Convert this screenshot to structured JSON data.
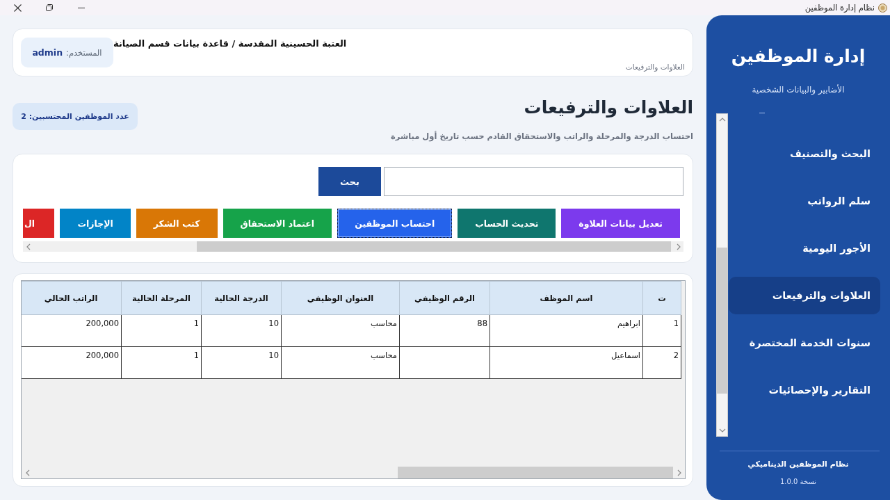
{
  "window": {
    "title": "نظام إدارة الموظفين"
  },
  "header": {
    "title": "العتبة الحسينية المقدسة / قاعدة بيانات قسم الصيانة",
    "user": "المستخدم: **admin**",
    "breadcrumb": "العلاوات والترفيعات"
  },
  "page": {
    "title": "العلاوات والترفيعات",
    "subtitle": "احتساب الدرجة والمرحلة والراتب والاستحقاق القادم حسب تاريخ أول مباشرة",
    "count": "عدد الموظفين المحتسبين: 2"
  },
  "search": {
    "button": "بحث"
  },
  "actions": [
    {
      "label": "تعديل بيانات العلاوة",
      "color": "#7c3aed",
      "focused": false
    },
    {
      "label": "تحديث الحساب",
      "color": "#0f766e",
      "focused": false
    },
    {
      "label": "احتساب الموظفين",
      "color": "#2563eb",
      "focused": true
    },
    {
      "label": "اعتماد الاستحقاق",
      "color": "#16a34a",
      "focused": false
    },
    {
      "label": "كتب الشكر",
      "color": "#d97706",
      "focused": false
    },
    {
      "label": "الإجازات",
      "color": "#0284c7",
      "focused": false
    },
    {
      "label": "ال",
      "color": "#dc2626",
      "focused": false
    }
  ],
  "table": {
    "columns": [
      "ت",
      "اسم الموظف",
      "الرقم الوظيفي",
      "العنوان الوظيفي",
      "الدرجة الحالية",
      "المرحلة الحالية",
      "الراتب الحالي"
    ],
    "rows": [
      {
        "seq": "1",
        "name": "ابراهيم",
        "employee_id": "88",
        "job_title": "محاسب",
        "grade": "10",
        "stage": "1",
        "salary": "200,000"
      },
      {
        "seq": "2",
        "name": "اسماعيل",
        "job_title": "محاسب",
        "grade": "10",
        "stage": "1",
        "salary": "200,000"
      }
    ]
  },
  "sidebar": {
    "title": "إدارة الموظفين",
    "subtitle": "الأضابير والبيانات الشخصية",
    "items": [
      {
        "label": "البحث والتصنيف",
        "selected": false
      },
      {
        "label": "سلم الرواتب",
        "selected": false
      },
      {
        "label": "الأجور اليومية",
        "selected": false
      },
      {
        "label": "العلاوات والترفيعات",
        "selected": true
      },
      {
        "label": "سنوات الخدمة المختصرة",
        "selected": false
      },
      {
        "label": "التقارير والإحصائيات",
        "selected": false
      }
    ],
    "footer": {
      "name": "نظام الموظفين الديناميكي",
      "version": "نسخة 1.0.0"
    }
  }
}
